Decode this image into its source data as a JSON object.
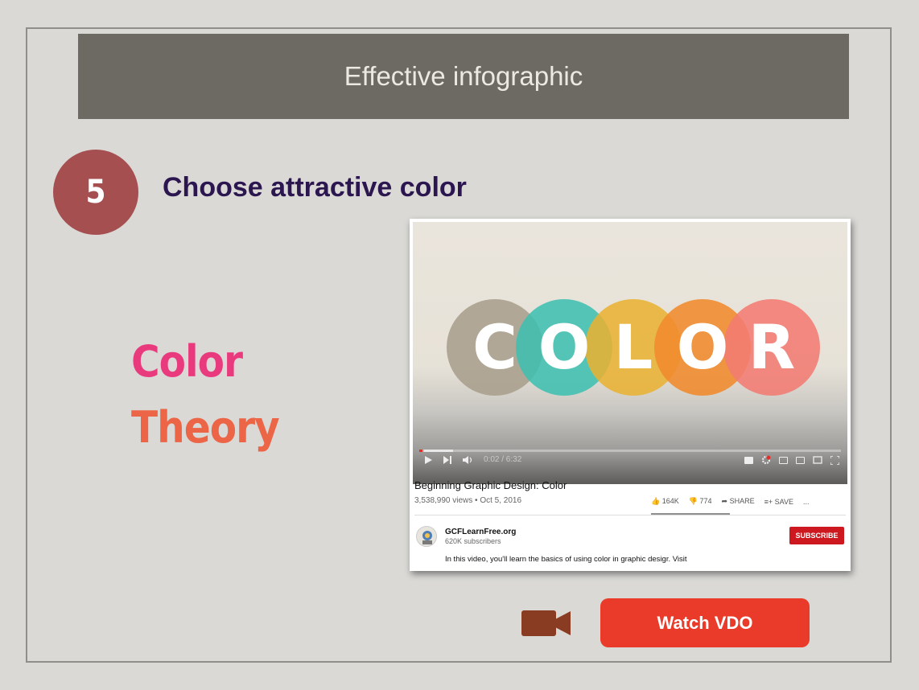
{
  "slide": {
    "title": "Effective infographic",
    "step_number": "5",
    "step_heading": "Choose attractive color",
    "topic_line1": "Color",
    "topic_line2": "Theory",
    "watch_button": "Watch VDO"
  },
  "video": {
    "logo_letters": [
      "C",
      "O",
      "L",
      "O",
      "R"
    ],
    "logo_colors": [
      "#a89e8c",
      "#3fbfb0",
      "#e8b234",
      "#f08a2c",
      "#f27b72"
    ],
    "time": "0:02 / 6:32",
    "progress_fraction": 0.005,
    "title": "Beginning Graphic Design: Color",
    "meta": "3,538,990 views • Oct 5, 2016",
    "likes": "164K",
    "dislikes": "774",
    "share_label": "SHARE",
    "save_label": "SAVE",
    "more_label": "...",
    "channel_name": "GCFLearnFree.org",
    "channel_subs": "620K subscribers",
    "subscribe_label": "SUBSCRIBE",
    "description": "In this video, you'll learn the basics of using color in graphic desigr. Visit"
  },
  "colors": {
    "title_bar": "#6c6a63",
    "step_circle": "#a54f51",
    "heading": "#2c1650",
    "color_word": "#e93a7d",
    "theory_word": "#ec6547",
    "watch_button": "#ea3b2a",
    "camera_icon": "#8a3c22"
  },
  "icons": [
    "play-icon",
    "next-icon",
    "volume-icon",
    "captions-icon",
    "settings-icon",
    "miniplayer-icon",
    "theater-icon",
    "cast-icon",
    "fullscreen-icon",
    "thumbs-up-icon",
    "thumbs-down-icon",
    "share-icon",
    "save-icon",
    "video-camera-icon"
  ]
}
